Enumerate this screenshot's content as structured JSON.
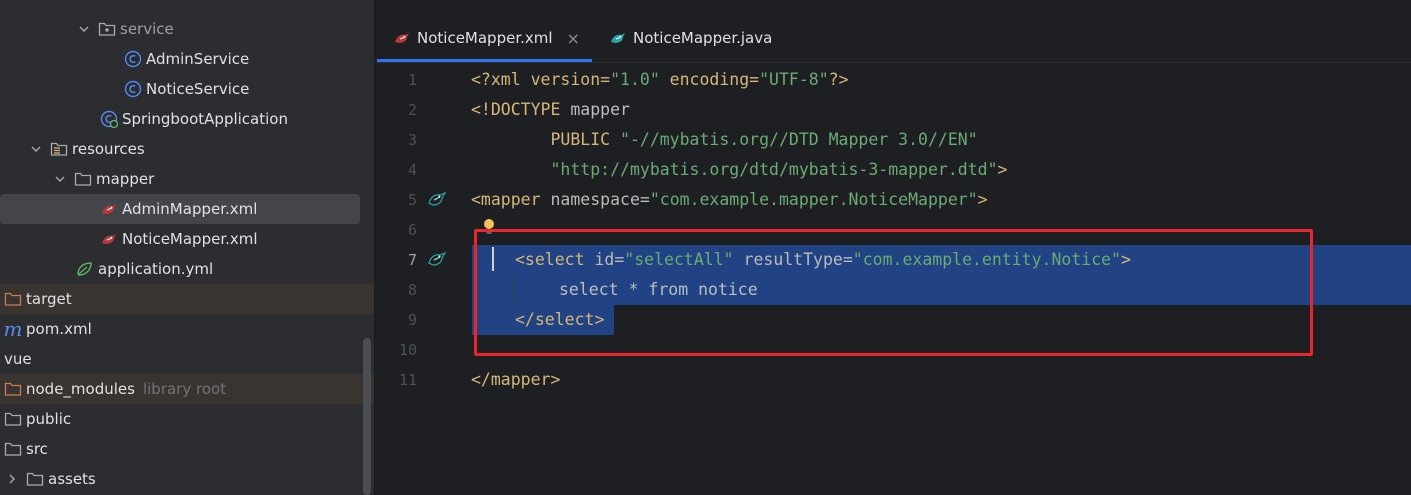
{
  "project_tree": {
    "items": [
      {
        "name": "service",
        "kind": "package",
        "indent": 1,
        "expanded": true
      },
      {
        "name": "AdminService",
        "kind": "class"
      },
      {
        "name": "NoticeService",
        "kind": "class"
      },
      {
        "name": "SpringbootApplication",
        "kind": "spring-class"
      },
      {
        "name": "resources",
        "kind": "resources-folder",
        "expanded": true
      },
      {
        "name": "mapper",
        "kind": "folder",
        "expanded": true
      },
      {
        "name": "AdminMapper.xml",
        "kind": "mybatis-xml",
        "selected": true
      },
      {
        "name": "NoticeMapper.xml",
        "kind": "mybatis-xml"
      },
      {
        "name": "application.yml",
        "kind": "spring-yaml"
      },
      {
        "name": "target",
        "kind": "excluded-folder"
      },
      {
        "name": "pom.xml",
        "kind": "maven"
      },
      {
        "name": "vue",
        "kind": "text"
      },
      {
        "name": "node_modules",
        "kind": "excluded-folder",
        "suffix": "library root"
      },
      {
        "name": "public",
        "kind": "folder"
      },
      {
        "name": "src",
        "kind": "folder"
      },
      {
        "name": "assets",
        "kind": "folder",
        "expanded": false
      }
    ]
  },
  "editor": {
    "tabs": [
      {
        "label": "NoticeMapper.xml",
        "active": true,
        "close": "×"
      },
      {
        "label": "NoticeMapper.java",
        "active": false
      }
    ],
    "line_numbers": [
      "1",
      "2",
      "3",
      "4",
      "5",
      "6",
      "7",
      "8",
      "9",
      "10",
      "11"
    ],
    "current_line": "7",
    "code": {
      "l1": {
        "a": "<?xml version=",
        "b": "\"1.0\"",
        "c": " encoding=",
        "d": "\"UTF-8\"",
        "e": "?>"
      },
      "l2": {
        "a": "<!DOCTYPE ",
        "b": "mapper"
      },
      "l3": {
        "a": "        PUBLIC ",
        "b": "\"-//mybatis.org//DTD Mapper 3.0//EN\""
      },
      "l4": {
        "a": "        ",
        "b": "\"http://mybatis.org/dtd/mybatis-3-mapper.dtd\"",
        "c": ">"
      },
      "l5": {
        "a": "<mapper ",
        "b": "namespace=",
        "c": "\"com.example.mapper.NoticeMapper\"",
        "d": ">"
      },
      "l7": {
        "a": "<select ",
        "b": "id=",
        "c": "\"selectAll\"",
        "d": " resultType=",
        "e": "\"com.example.entity.Notice\"",
        "f": ">"
      },
      "l8": {
        "a": "select * from notice"
      },
      "l9": {
        "a": "</select>"
      },
      "l11": {
        "a": "</mapper>"
      }
    }
  },
  "colors": {
    "selection": "#214283",
    "annotation_box": "#e8262b",
    "tab_accent": "#3574f0"
  }
}
